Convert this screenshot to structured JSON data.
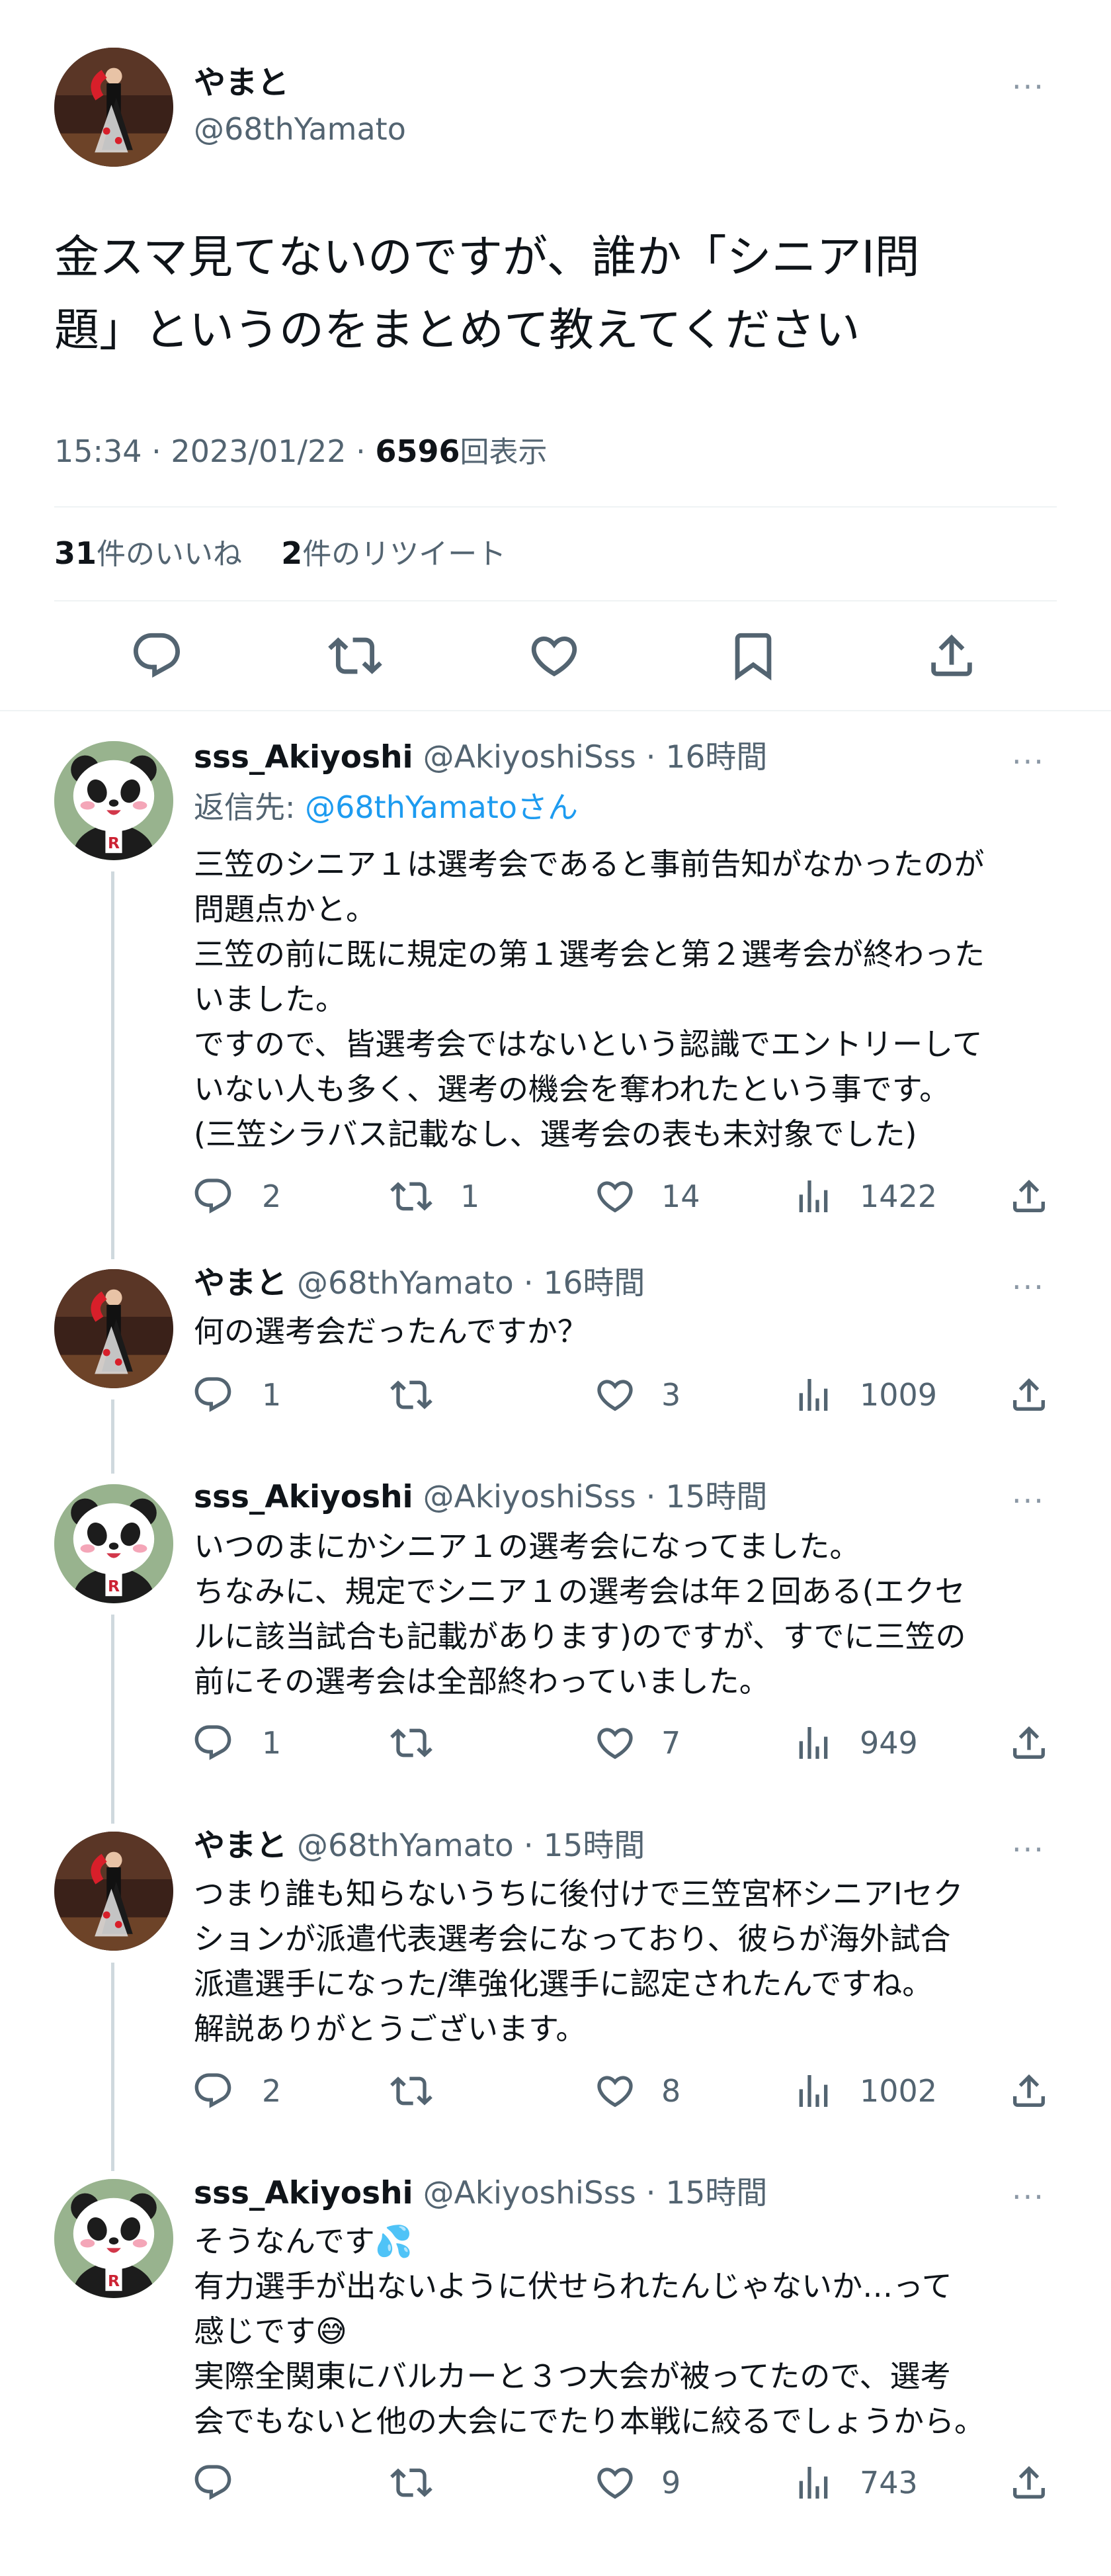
{
  "main": {
    "name": "やまと",
    "handle": "@68thYamato",
    "text": "金スマ見てないのですが、誰か「シニアⅠ問\n題」というのをまとめて教えてください",
    "time": "15:34 · 2023/01/22 · ",
    "views": "6596",
    "views_label": "回表示",
    "likes_count": "31",
    "likes_label": "件のいいね",
    "retweets_count": "2",
    "retweets_label": "件のリツイート"
  },
  "replies": [
    {
      "name": "sss_Akiyoshi",
      "handle": "@AkiyoshiSss · 16時間",
      "reply_to_label": "返信先: ",
      "reply_to_user": "@68thYamatoさん",
      "text": "三笠のシニア１は選考会であると事前告知がなかったのが\n問題点かと。\n三笠の前に既に規定の第１選考会と第２選考会が終わった\nいました。\nですので、皆選考会ではないという認識でエントリーして\nいない人も多く、選考の機会を奪われたという事です。\n(三笠シラバス記載なし、選考会の表も未対象でした)",
      "replies": "2",
      "retweets": "1",
      "likes": "14",
      "views": "1422"
    },
    {
      "name": "やまと",
      "handle": "@68thYamato · 16時間",
      "text": "何の選考会だったんですか？",
      "replies": "1",
      "retweets": "",
      "likes": "3",
      "views": "1009"
    },
    {
      "name": "sss_Akiyoshi",
      "handle": "@AkiyoshiSss · 15時間",
      "text": "いつのまにかシニア１の選考会になってました。\nちなみに、規定でシニア１の選考会は年２回ある(エクセ\nルに該当試合も記載があります)のですが、すでに三笠の\n前にその選考会は全部終わっていました。",
      "replies": "1",
      "retweets": "",
      "likes": "7",
      "views": "949"
    },
    {
      "name": "やまと",
      "handle": "@68thYamato · 15時間",
      "text": "つまり誰も知らないうちに後付けで三笠宮杯シニアⅠセク\nションが派遣代表選考会になっており、彼らが海外試合\n派遣選手になった/準強化選手に認定されたんですね。\n解説ありがとうございます。",
      "replies": "2",
      "retweets": "",
      "likes": "8",
      "views": "1002"
    },
    {
      "name": "sss_Akiyoshi",
      "handle": "@AkiyoshiSss · 15時間",
      "text": "そうなんです💦\n有力選手が出ないように伏せられたんじゃないか…って\n感じです😅\n実際全関東にバルカーと３つ大会が被ってたので、選考\n会でもないと他の大会にでたり本戦に絞るでしょうから。",
      "replies": "",
      "retweets": "",
      "likes": "9",
      "views": "743"
    }
  ],
  "more_glyph": "···",
  "colors": {
    "accent": "#1d9bf0",
    "muted": "#536471",
    "border": "#eff3f4"
  }
}
